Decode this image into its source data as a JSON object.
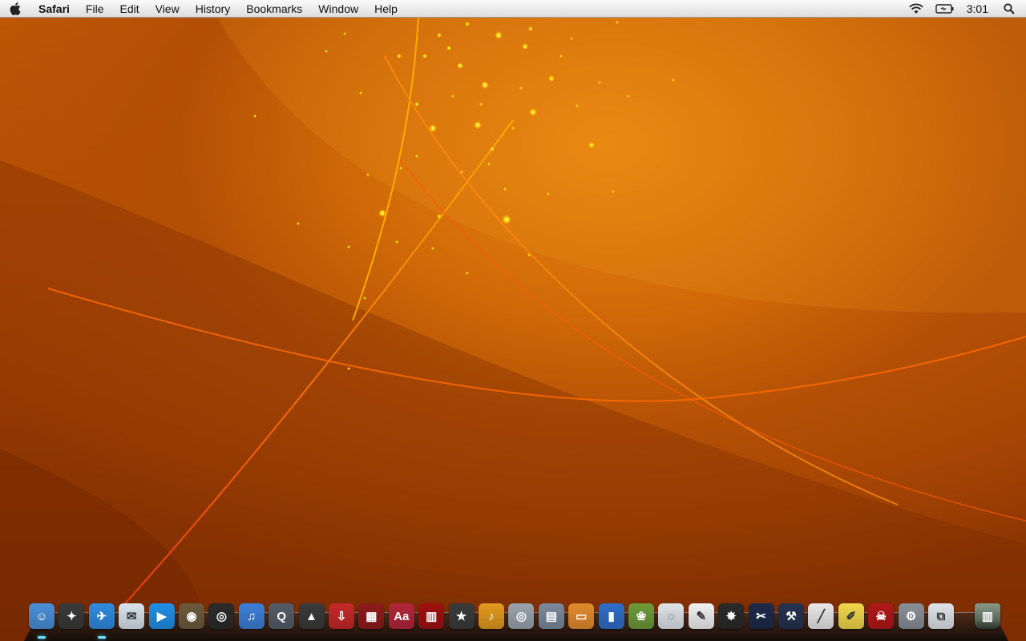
{
  "menubar": {
    "apple_icon": "apple-icon",
    "app_name": "Safari",
    "items": [
      "File",
      "Edit",
      "View",
      "History",
      "Bookmarks",
      "Window",
      "Help"
    ],
    "status_icons": [
      "wifi-icon",
      "battery-icon"
    ],
    "clock": "3:01",
    "spotlight_icon": "spotlight-search-icon"
  },
  "dock": {
    "apps": [
      {
        "name": "finder",
        "icon": "finder-icon",
        "color": "#4a8fd8",
        "glyph": "☺"
      },
      {
        "name": "launchpad",
        "icon": "launchpad-icon",
        "color": "#3a3a3a",
        "glyph": "✦"
      },
      {
        "name": "safari",
        "icon": "safari-icon",
        "color": "#2f8be0",
        "glyph": "✈"
      },
      {
        "name": "mail",
        "icon": "mail-icon",
        "color": "#d9e3ee",
        "glyph": "✉"
      },
      {
        "name": "facetime",
        "icon": "facetime-icon",
        "color": "#1f8fe6",
        "glyph": "▶"
      },
      {
        "name": "photo-booth",
        "icon": "photo-booth-icon",
        "color": "#6d5a3c",
        "glyph": "◉"
      },
      {
        "name": "aperture",
        "icon": "aperture-icon",
        "color": "#2b2b2b",
        "glyph": "◎"
      },
      {
        "name": "itunes",
        "icon": "itunes-icon",
        "color": "#3d7fd6",
        "glyph": "♫"
      },
      {
        "name": "quicktime",
        "icon": "quicktime-icon",
        "color": "#555c66",
        "glyph": "Q"
      },
      {
        "name": "vlc",
        "icon": "vlc-icon",
        "color": "#3a3a3a",
        "glyph": "▲"
      },
      {
        "name": "downloads",
        "icon": "downloads-icon",
        "color": "#c62828",
        "glyph": "⇩"
      },
      {
        "name": "photo-slides",
        "icon": "photo-slides-icon",
        "color": "#8e1b1b",
        "glyph": "▦"
      },
      {
        "name": "dictionary",
        "icon": "dictionary-icon",
        "color": "#b3263a",
        "glyph": "Aa"
      },
      {
        "name": "photo-booth-curtain",
        "icon": "curtain-icon",
        "color": "#a01010",
        "glyph": "▥"
      },
      {
        "name": "imovie",
        "icon": "imovie-icon",
        "color": "#3b3b3b",
        "glyph": "★"
      },
      {
        "name": "garageband",
        "icon": "garageband-icon",
        "color": "#e39a1e",
        "glyph": "♪"
      },
      {
        "name": "dvd-player",
        "icon": "dvd-player-icon",
        "color": "#9aa3ad",
        "glyph": "◎"
      },
      {
        "name": "preview",
        "icon": "preview-icon",
        "color": "#7b8a9c",
        "glyph": "▤"
      },
      {
        "name": "pages",
        "icon": "pages-icon",
        "color": "#e38b2c",
        "glyph": "▭"
      },
      {
        "name": "numbers",
        "icon": "numbers-icon",
        "color": "#2f6fc9",
        "glyph": "▮"
      },
      {
        "name": "iphoto",
        "icon": "iphoto-icon",
        "color": "#6d9a3a",
        "glyph": "❀"
      },
      {
        "name": "ical",
        "icon": "ical-icon",
        "color": "#dfe3e8",
        "glyph": "◌"
      },
      {
        "name": "textedit",
        "icon": "textedit-icon",
        "color": "#f2f2f2",
        "glyph": "✎"
      },
      {
        "name": "color-picker",
        "icon": "color-picker-icon",
        "color": "#2a2a2a",
        "glyph": "✸"
      },
      {
        "name": "final-cut",
        "icon": "final-cut-icon",
        "color": "#1f2a4a",
        "glyph": "✂"
      },
      {
        "name": "xcode",
        "icon": "xcode-icon",
        "color": "#27324f",
        "glyph": "⚒"
      },
      {
        "name": "pen-tool",
        "icon": "pen-tool-icon",
        "color": "#e8e8e8",
        "glyph": "╱"
      },
      {
        "name": "stickies",
        "icon": "stickies-icon",
        "color": "#f0d84a",
        "glyph": "✐"
      },
      {
        "name": "game",
        "icon": "game-icon",
        "color": "#b01818",
        "glyph": "☠"
      },
      {
        "name": "system-preferences",
        "icon": "system-preferences-icon",
        "color": "#8a8f96",
        "glyph": "⚙"
      },
      {
        "name": "parallels",
        "icon": "parallels-icon",
        "color": "#dfe4ea",
        "glyph": "⧉"
      }
    ],
    "trash": {
      "name": "trash",
      "icon": "trash-icon",
      "color": "#5c6a5c",
      "glyph": "▥"
    }
  }
}
